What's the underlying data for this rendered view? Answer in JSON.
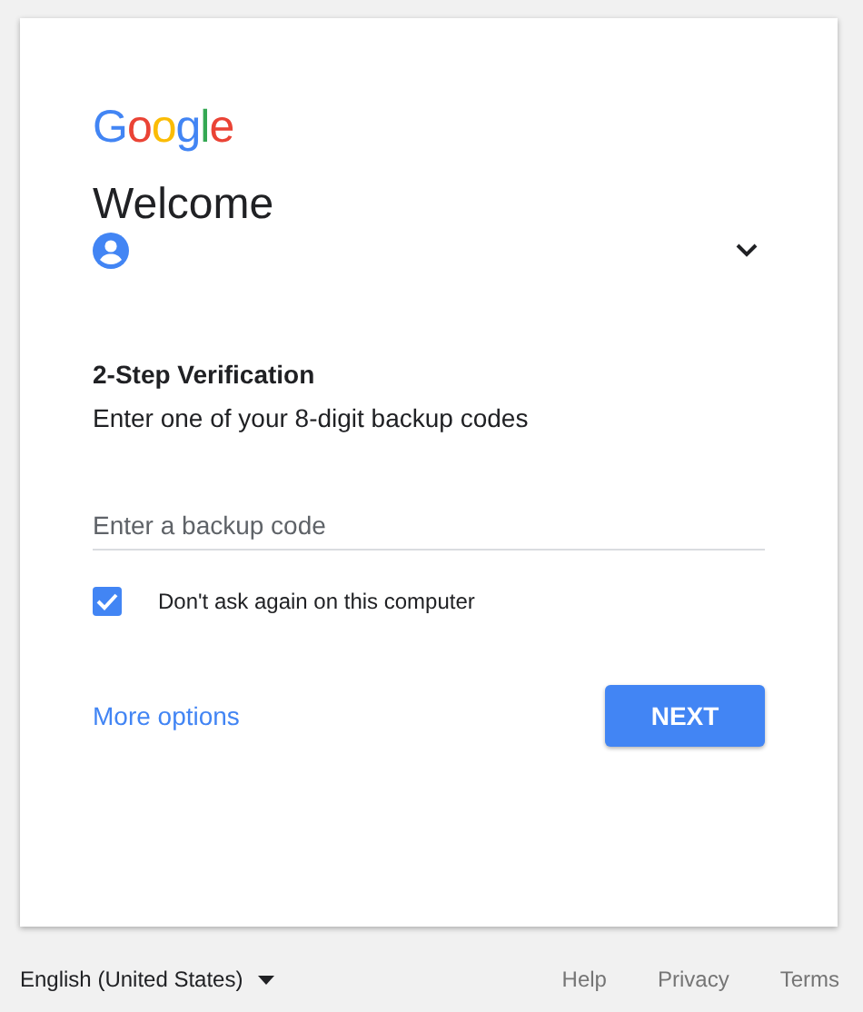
{
  "logo": {
    "letters": [
      {
        "char": "G",
        "color": "#4285f4"
      },
      {
        "char": "o",
        "color": "#ea4335"
      },
      {
        "char": "o",
        "color": "#fbbc05"
      },
      {
        "char": "g",
        "color": "#4285f4"
      },
      {
        "char": "l",
        "color": "#34a853"
      },
      {
        "char": "e",
        "color": "#ea4335"
      }
    ]
  },
  "heading": "Welcome",
  "section_title": "2-Step Verification",
  "instruction": "Enter one of your 8-digit backup codes",
  "code_field": {
    "placeholder": "Enter a backup code"
  },
  "remember": {
    "label": "Don't ask again on this computer",
    "checked": true
  },
  "more_options": "More options",
  "next_button": "NEXT",
  "footer": {
    "language": "English (United States)",
    "links": [
      "Help",
      "Privacy",
      "Terms"
    ]
  }
}
